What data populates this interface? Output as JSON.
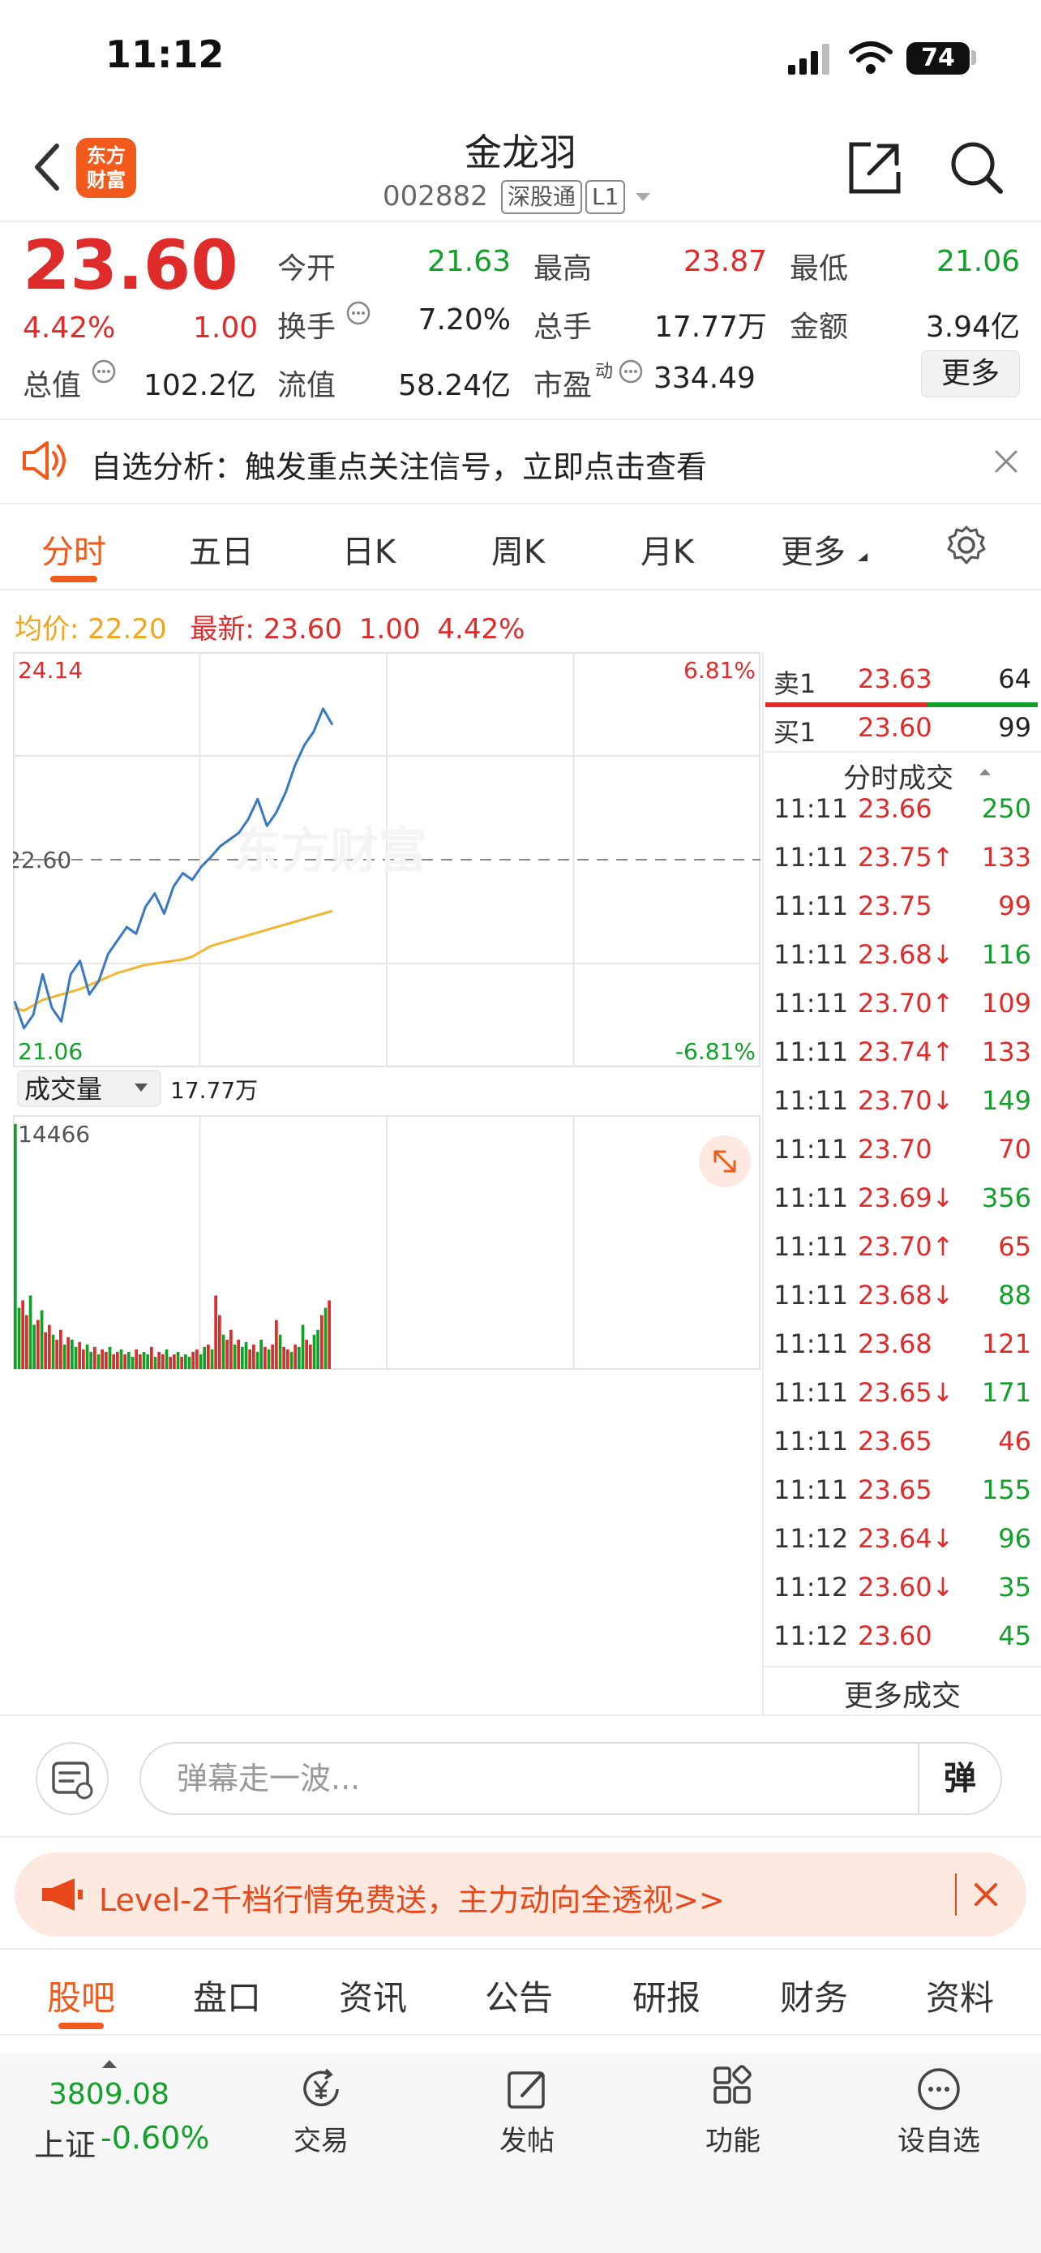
{
  "status": {
    "time": "11:12",
    "battery": "74"
  },
  "header": {
    "title": "金龙羽",
    "code": "002882",
    "tag_market": "深股通",
    "tag_level": "L1",
    "logo_line1": "东方",
    "logo_line2": "财富"
  },
  "quote": {
    "price": "23.60",
    "change_pct": "4.42%",
    "change": "1.00",
    "rows": [
      [
        {
          "l": "今开",
          "v": "21.63",
          "c": "green"
        },
        {
          "l": "最高",
          "v": "23.87",
          "c": "red"
        },
        {
          "l": "最低",
          "v": "21.06",
          "c": "green"
        }
      ],
      [
        {
          "l": "换手",
          "v": "7.20%",
          "c": "dark"
        },
        {
          "l": "总手",
          "v": "17.77万",
          "c": "dark"
        },
        {
          "l": "金额",
          "v": "3.94亿",
          "c": "dark"
        }
      ],
      [
        {
          "l": "流值",
          "v": "58.24亿",
          "c": "dark"
        },
        {
          "l": "市盈",
          "v": "334.49",
          "c": "dark"
        }
      ]
    ],
    "total_mv_label": "总值",
    "total_mv": "102.2亿",
    "pe_sup": "动",
    "more": "更多"
  },
  "notice": {
    "text": "自选分析：触发重点关注信号，立即点击查看"
  },
  "tabs": [
    "分时",
    "五日",
    "日K",
    "周K",
    "月K",
    "更多"
  ],
  "avg": {
    "avg_label": "均价:",
    "avg_value": "22.20",
    "last_label": "最新:",
    "last_value": "23.60",
    "change": "1.00",
    "change_pct": "4.42%"
  },
  "chart_data": {
    "type": "line",
    "title": "",
    "y_max": "24.14",
    "y_min": "21.06",
    "y_mid": "22.60",
    "pct_max": "6.81%",
    "pct_min": "-6.81%",
    "ylim": [
      21.06,
      24.14
    ],
    "prev_close": 22.6,
    "x_start": "09:30",
    "x_end": "15:00",
    "watermark": "东方财富",
    "series": [
      {
        "values": [
          21.55,
          21.35,
          21.45,
          21.75,
          21.5,
          21.4,
          21.75,
          21.85,
          21.6,
          21.7,
          21.9,
          22.0,
          22.1,
          22.05,
          22.25,
          22.35,
          22.2,
          22.4,
          22.5,
          22.45,
          22.55,
          22.62,
          22.7,
          22.75,
          22.8,
          22.9,
          23.05,
          22.85,
          22.95,
          23.1,
          23.3,
          23.45,
          23.55,
          23.72,
          23.6
        ]
      },
      {
        "values": [
          21.5,
          21.48,
          21.52,
          21.56,
          21.58,
          21.6,
          21.62,
          21.64,
          21.67,
          21.7,
          21.73,
          21.76,
          21.78,
          21.8,
          21.82,
          21.83,
          21.84,
          21.85,
          21.86,
          21.88,
          21.92,
          21.96,
          21.98,
          22.0,
          22.02,
          22.04,
          22.06,
          22.08,
          22.1,
          22.12,
          22.14,
          22.16,
          22.18,
          22.2,
          22.22
        ]
      }
    ],
    "volume": {
      "label": "成交量",
      "total": "17.77万",
      "max_label": "14466",
      "bars": [
        1.0,
        0.25,
        0.28,
        0.22,
        0.3,
        0.18,
        0.2,
        0.24,
        0.15,
        0.18,
        0.14,
        0.12,
        0.16,
        0.1,
        0.13,
        0.12,
        0.09,
        0.11,
        0.08,
        0.1,
        0.07,
        0.09,
        0.06,
        0.08,
        0.07,
        0.09,
        0.06,
        0.07,
        0.08,
        0.06,
        0.07,
        0.05,
        0.08,
        0.06,
        0.07,
        0.06,
        0.09,
        0.05,
        0.07,
        0.06,
        0.08,
        0.05,
        0.06,
        0.07,
        0.05,
        0.06,
        0.05,
        0.07,
        0.08,
        0.06,
        0.09,
        0.1,
        0.08,
        0.3,
        0.22,
        0.14,
        0.12,
        0.16,
        0.1,
        0.12,
        0.09,
        0.11,
        0.08,
        0.1,
        0.07,
        0.12,
        0.09,
        0.08,
        0.1,
        0.2,
        0.14,
        0.09,
        0.08,
        0.07,
        0.1,
        0.09,
        0.18,
        0.12,
        0.1,
        0.14,
        0.16,
        0.22,
        0.25,
        0.28
      ]
    }
  },
  "orderbook": {
    "ask": {
      "label": "卖1",
      "price": "23.63",
      "vol": "64"
    },
    "bid": {
      "label": "买1",
      "price": "23.60",
      "vol": "99"
    },
    "ticks_title": "分时成交",
    "ticks": [
      {
        "t": "11:11",
        "p": "23.66",
        "a": "",
        "v": "250",
        "vc": "green"
      },
      {
        "t": "11:11",
        "p": "23.75",
        "a": "↑",
        "v": "133",
        "vc": "red"
      },
      {
        "t": "11:11",
        "p": "23.75",
        "a": "",
        "v": "99",
        "vc": "red"
      },
      {
        "t": "11:11",
        "p": "23.68",
        "a": "↓",
        "v": "116",
        "vc": "green"
      },
      {
        "t": "11:11",
        "p": "23.70",
        "a": "↑",
        "v": "109",
        "vc": "red"
      },
      {
        "t": "11:11",
        "p": "23.74",
        "a": "↑",
        "v": "133",
        "vc": "red"
      },
      {
        "t": "11:11",
        "p": "23.70",
        "a": "↓",
        "v": "149",
        "vc": "green"
      },
      {
        "t": "11:11",
        "p": "23.70",
        "a": "",
        "v": "70",
        "vc": "red"
      },
      {
        "t": "11:11",
        "p": "23.69",
        "a": "↓",
        "v": "356",
        "vc": "green"
      },
      {
        "t": "11:11",
        "p": "23.70",
        "a": "↑",
        "v": "65",
        "vc": "red"
      },
      {
        "t": "11:11",
        "p": "23.68",
        "a": "↓",
        "v": "88",
        "vc": "green"
      },
      {
        "t": "11:11",
        "p": "23.68",
        "a": "",
        "v": "121",
        "vc": "red"
      },
      {
        "t": "11:11",
        "p": "23.65",
        "a": "↓",
        "v": "171",
        "vc": "green"
      },
      {
        "t": "11:11",
        "p": "23.65",
        "a": "",
        "v": "46",
        "vc": "red"
      },
      {
        "t": "11:11",
        "p": "23.65",
        "a": "",
        "v": "155",
        "vc": "green"
      },
      {
        "t": "11:12",
        "p": "23.64",
        "a": "↓",
        "v": "96",
        "vc": "green"
      },
      {
        "t": "11:12",
        "p": "23.60",
        "a": "↓",
        "v": "35",
        "vc": "green"
      },
      {
        "t": "11:12",
        "p": "23.60",
        "a": "",
        "v": "45",
        "vc": "green"
      }
    ],
    "more": "更多成交"
  },
  "comment": {
    "placeholder": "弹幕走一波...",
    "danmu": "弹"
  },
  "banner": {
    "text": "Level-2千档行情免费送，主力动向全透视>>"
  },
  "bottom_tabs": [
    "股吧",
    "盘口",
    "资讯",
    "公告",
    "研报",
    "财务",
    "资料"
  ],
  "footer": {
    "index_value": "3809.08",
    "index_name": "上证",
    "index_change": "-0.60%",
    "items": [
      "交易",
      "发帖",
      "功能",
      "设自选"
    ]
  },
  "colors": {
    "accent": "#f25a1b",
    "up": "#e02b2b",
    "down": "#12a02b",
    "price_line": "#3a78c3",
    "avg_line": "#f2b632"
  }
}
